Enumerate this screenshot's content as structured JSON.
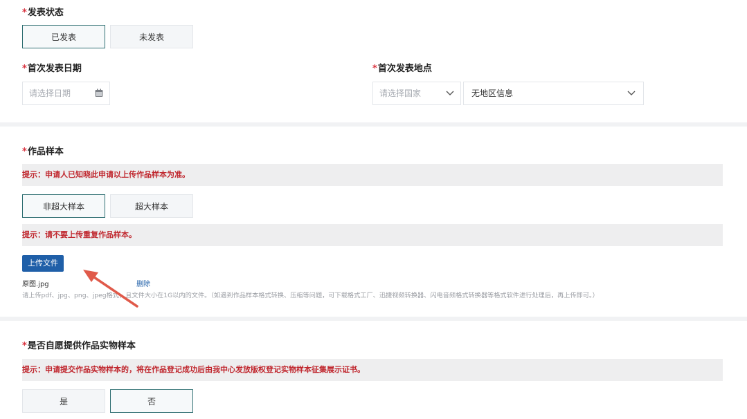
{
  "status_section": {
    "label": "发表状态",
    "options": [
      "已发表",
      "未发表"
    ]
  },
  "first_date": {
    "label": "首次发表日期",
    "placeholder": "请选择日期"
  },
  "first_place": {
    "label": "首次发表地点",
    "country_placeholder": "请选择国家",
    "region_value": "无地区信息"
  },
  "sample_section": {
    "label": "作品样本",
    "tip1": "提示：申请人已知晓此申请以上传作品样本为准。",
    "options": [
      "非超大样本",
      "超大样本"
    ],
    "tip2": "提示：请不要上传重复作品样本。",
    "upload_button": "上传文件",
    "file_name": "原图.jpg",
    "delete_label": "删除",
    "hint": "请上传pdf、jpg、png、jpeg格式，且文件大小在1G以内的文件。（如遇到作品样本格式转换、压缩等问题，可下载格式工厂、迅捷视频转换器、闪电音频格式转换器等格式软件进行处理后，再上传即可。）"
  },
  "physical_section": {
    "label": "是否自愿提供作品实物样本",
    "tip": "提示：申请提交作品实物样本的，将在作品登记成功后由我中心发放版权登记实物样本征集展示证书。",
    "options": [
      "是",
      "否"
    ]
  },
  "required_mark": "*",
  "colors": {
    "required": "#d9333f",
    "tip_text": "#c0282f",
    "active_border": "#2f6f72",
    "upload_button": "#1f5fa8",
    "link": "#1f5fa8",
    "arrow": "#e05a4a"
  }
}
